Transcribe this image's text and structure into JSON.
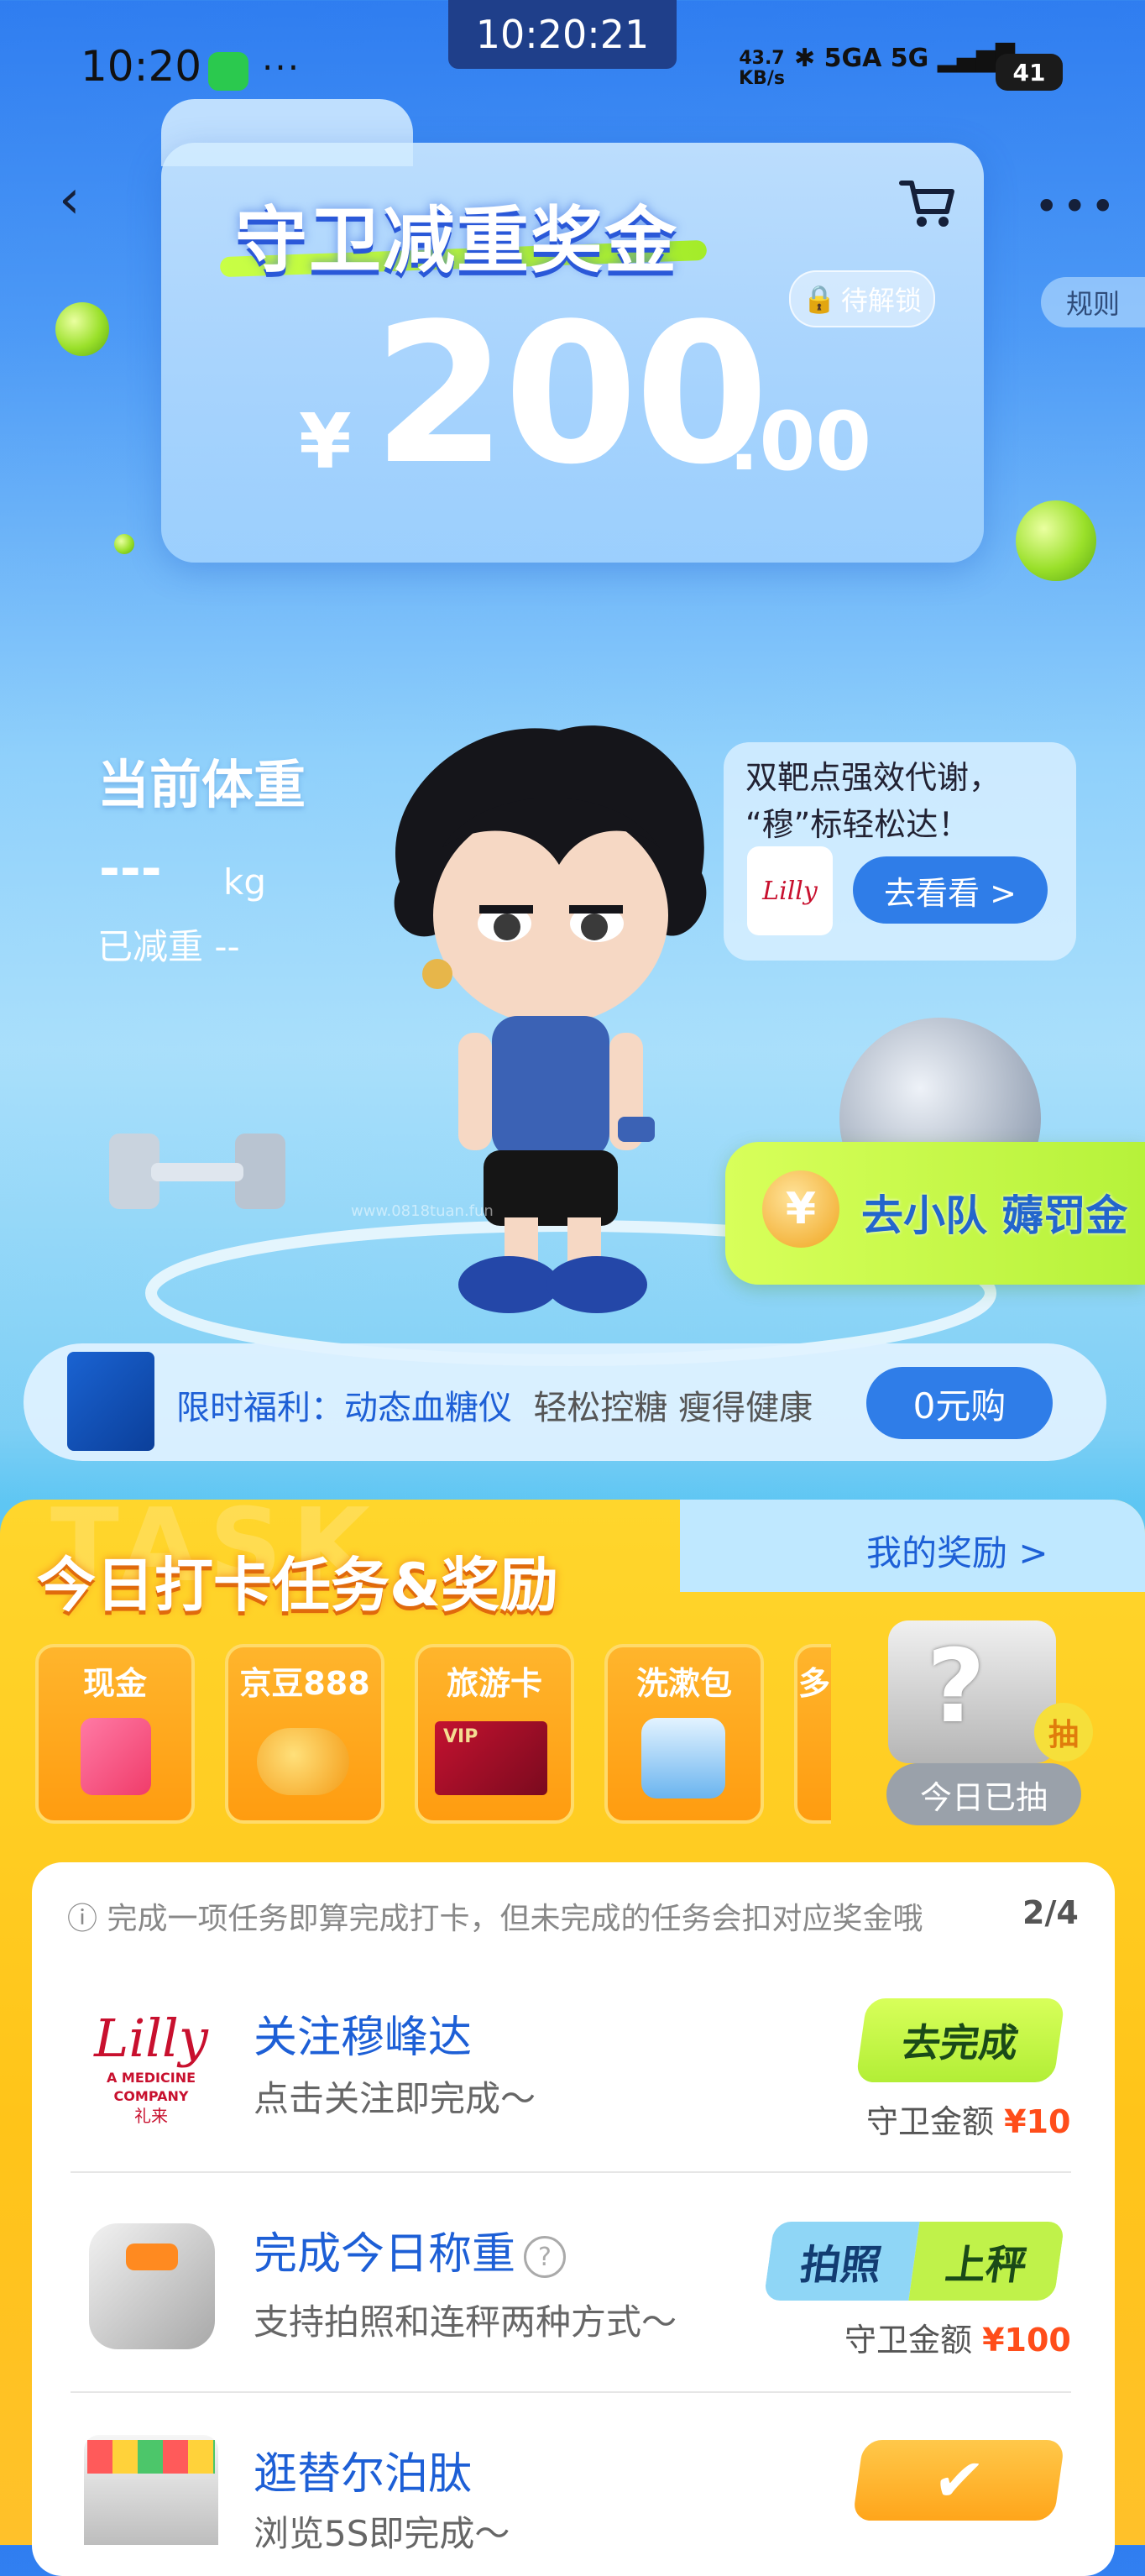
{
  "status_bar": {
    "time": "10:20",
    "overlay_clock": "10:20:21",
    "speed_value": "43.7",
    "speed_unit": "KB/s",
    "network": "✱ 5GA 5G",
    "battery": "41"
  },
  "header": {
    "rules": "规则"
  },
  "bonus": {
    "title": "守卫减重奖金",
    "lock_status": "待解锁",
    "currency": "¥",
    "amount": "200",
    "cents": ".00"
  },
  "weight": {
    "label": "当前体重",
    "value": "---",
    "unit": "kg",
    "lost": "已减重 --"
  },
  "promo": {
    "line1": "双靶点强效代谢，",
    "line2": "“穆”标轻松达！",
    "logo": "Lilly",
    "button": "去看看 >"
  },
  "penalty": {
    "coin": "¥",
    "text": "去小队 薅罚金"
  },
  "benefit": {
    "highlight": "限时福利：动态血糖仪",
    "sub": "轻松控糖 瘦得健康",
    "button": "0元购"
  },
  "task_panel": {
    "bg_text": "TASK",
    "title": "今日打卡任务&奖励",
    "my_reward": "我的奖励 >",
    "rewards": [
      {
        "label": "现金"
      },
      {
        "label": "京豆888"
      },
      {
        "label": "旅游卡"
      },
      {
        "label": "洗漱包"
      },
      {
        "label": "多"
      }
    ],
    "mystery_badge": "抽",
    "drawn_today": "今日已抽",
    "notice": "完成一项任务即算完成打卡，但未完成的任务会扣对应奖金哦",
    "progress": "2/4"
  },
  "tasks": [
    {
      "logo_line1": "Lilly",
      "logo_line2": "A MEDICINE COMPANY",
      "logo_line3": "礼来",
      "title": "关注穆峰达",
      "subtitle": "点击关注即完成～",
      "button": "去完成",
      "reward_label": "守卫金额",
      "reward_value": "¥10"
    },
    {
      "title": "完成今日称重",
      "subtitle": "支持拍照和连秤两种方式～",
      "button_a": "拍照",
      "button_b": "上秤",
      "reward_label": "守卫金额",
      "reward_value": "¥100"
    },
    {
      "title": "逛替尔泊肽",
      "subtitle": "浏览5S即完成～",
      "button": "✔"
    }
  ],
  "card_visual": {
    "reward_card_text": "VIP"
  },
  "colors": {
    "accent_blue": "#2f7de8",
    "task_yellow": "#ffc419",
    "lime": "#c0f24a"
  }
}
